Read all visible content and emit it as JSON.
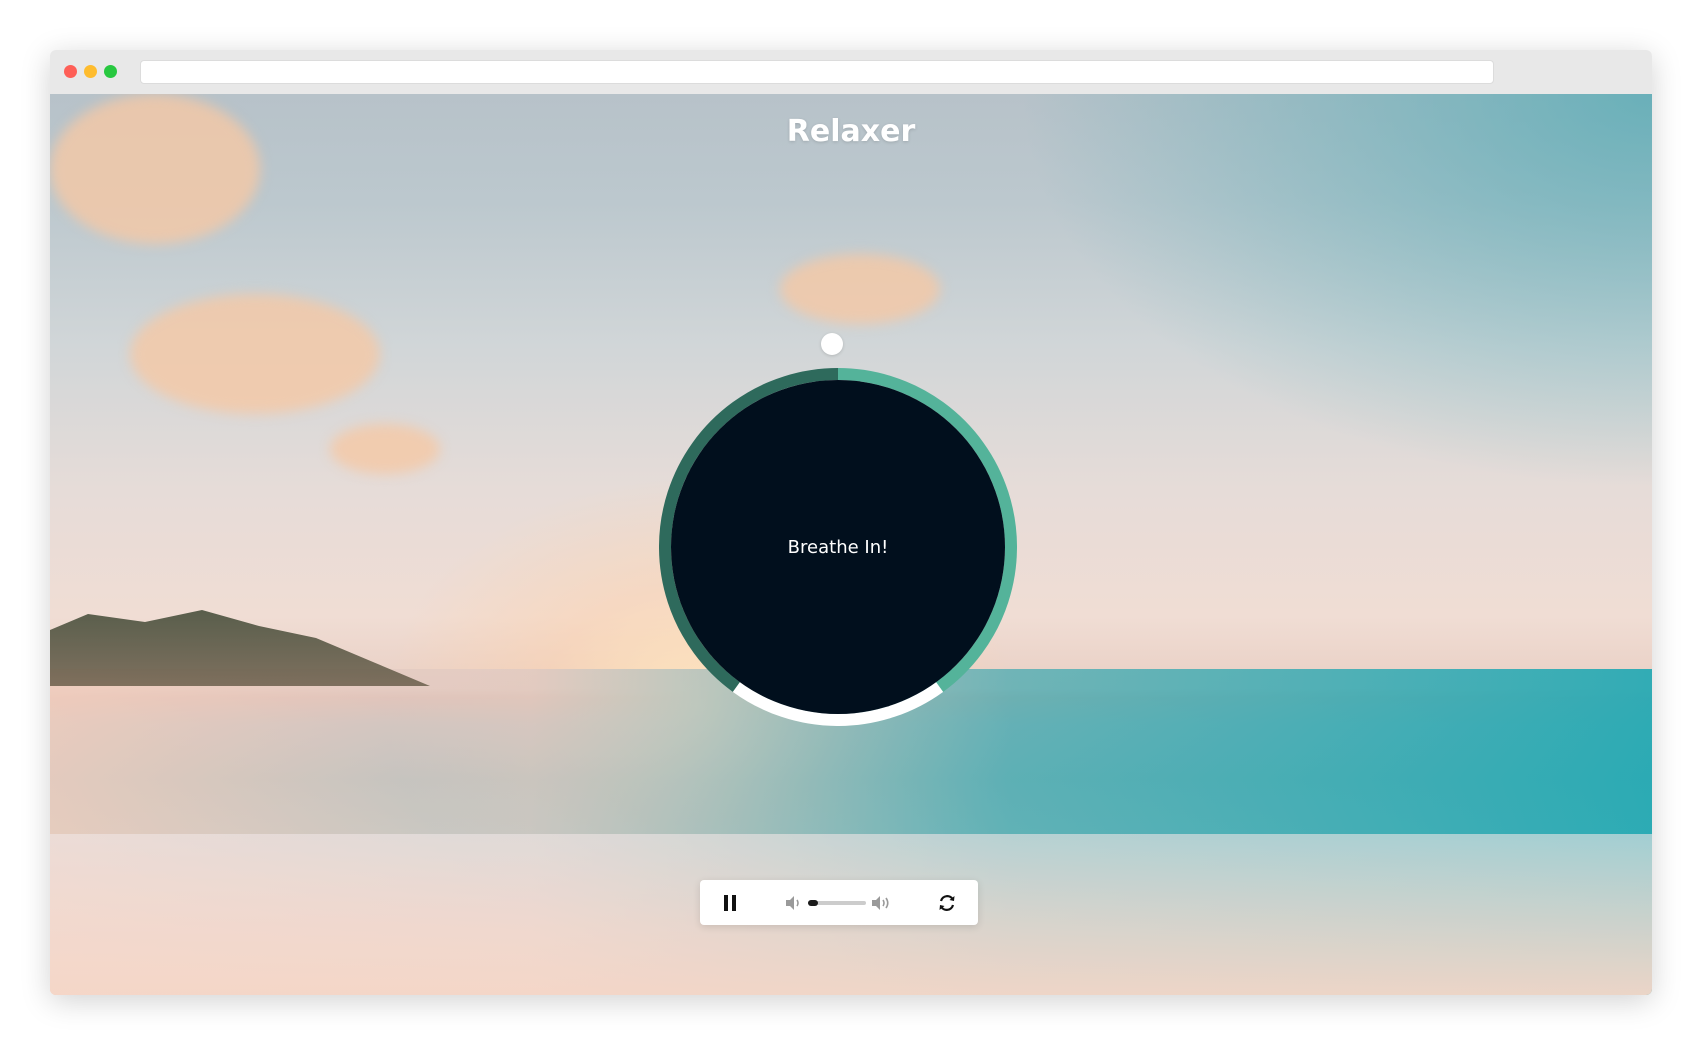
{
  "app": {
    "title": "Relaxer"
  },
  "breath": {
    "instruction": "Breathe In!"
  },
  "player": {
    "state": "playing",
    "volume": 0.18,
    "icons": {
      "pause": "pause-icon",
      "volume_low": "volume-low-icon",
      "volume_high": "volume-high-icon",
      "refresh": "refresh-icon"
    }
  },
  "colors": {
    "circle": "#010f1d",
    "ring_dark": "#2e6a5c",
    "ring_light": "#54b39a",
    "ring_exhale": "#ffffff"
  }
}
